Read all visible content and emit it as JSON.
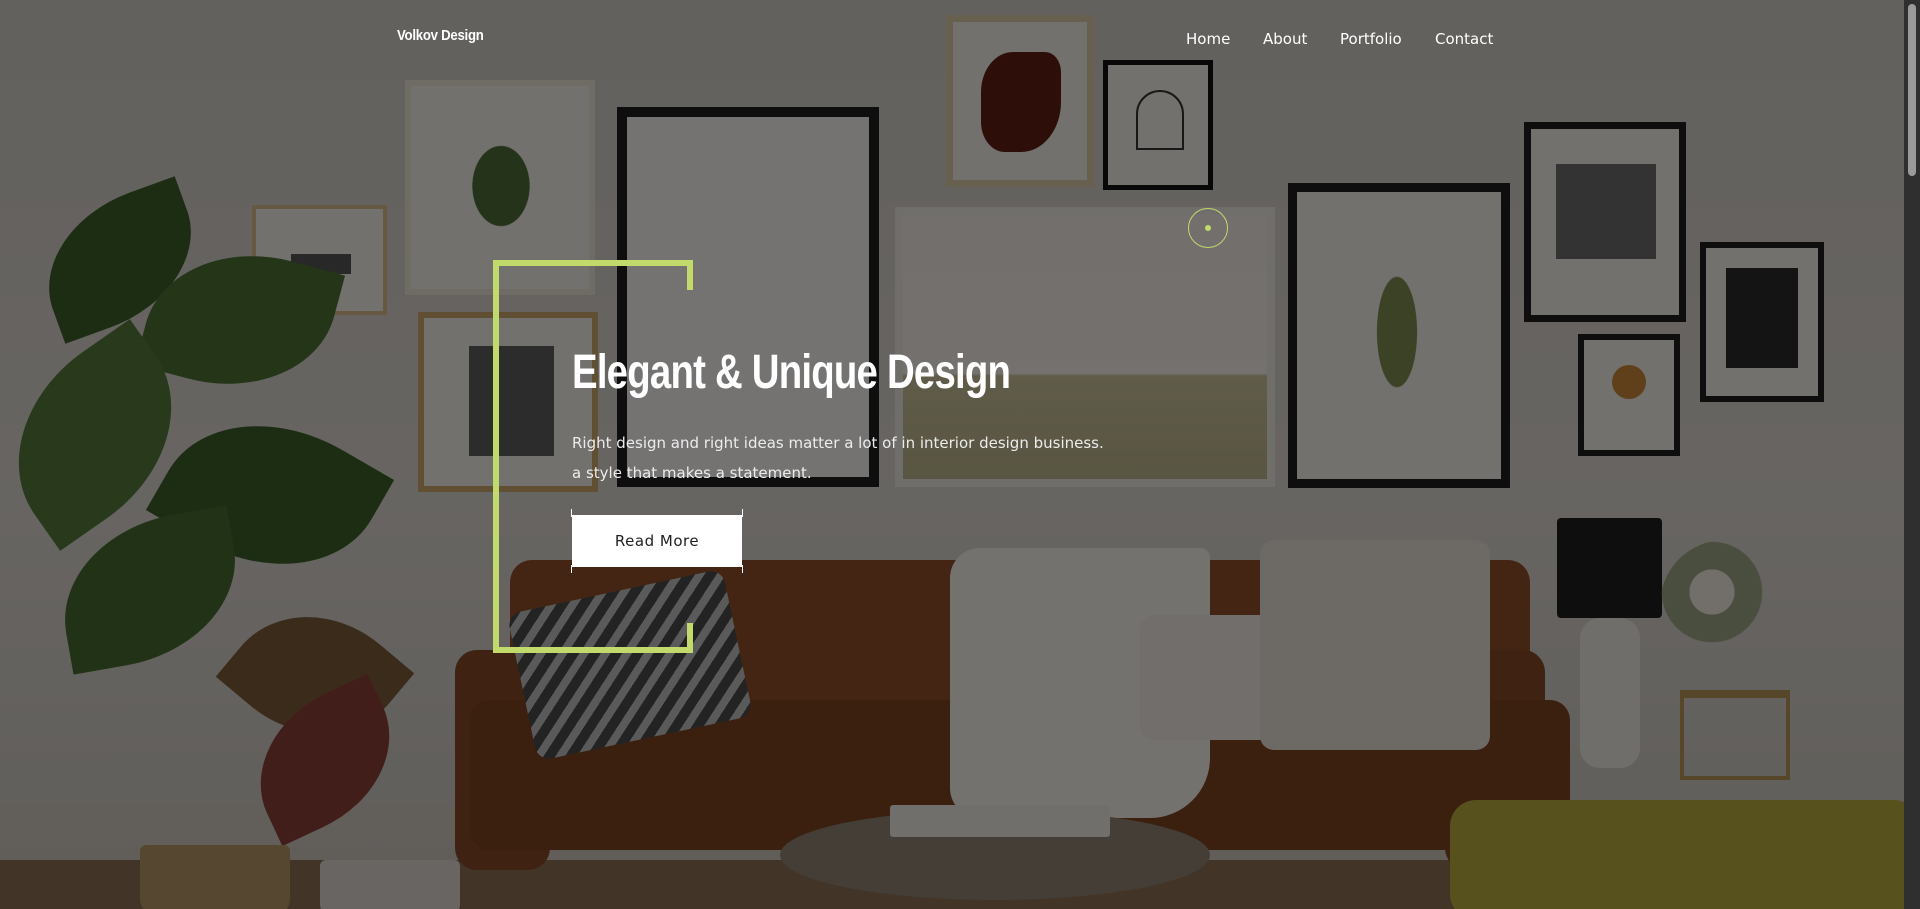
{
  "brand": {
    "name": "Volkov Design"
  },
  "nav": {
    "items": [
      "Home",
      "About",
      "Portfolio",
      "Contact"
    ]
  },
  "hero": {
    "title": "Elegant & Unique Design",
    "lines": [
      "Right design and right ideas matter a lot of in interior design business.",
      "a style that makes a statement."
    ],
    "button_label": "Read More"
  },
  "colors": {
    "accent": "#c2d96c",
    "text": "#ffffff",
    "button_bg": "#ffffff",
    "button_text": "#1f1f1f"
  },
  "icons": {
    "cursor": "circle-cursor-icon"
  }
}
